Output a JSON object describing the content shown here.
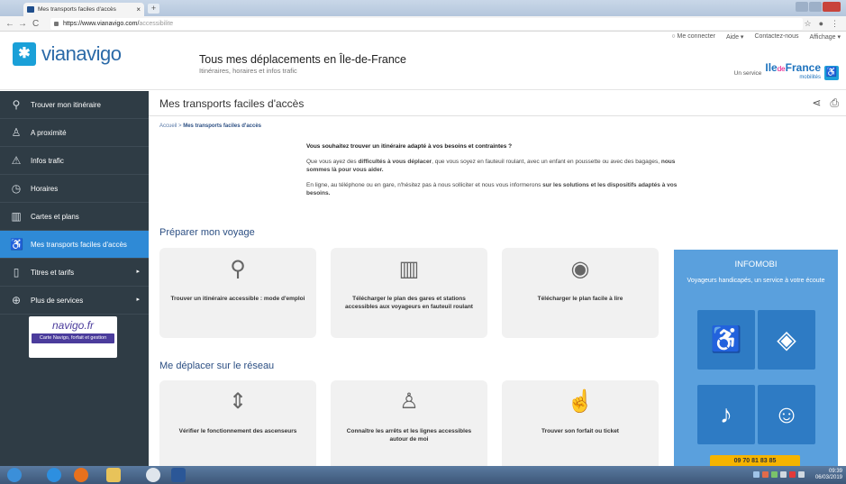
{
  "browser": {
    "tab_title": "Mes transports faciles d'accès",
    "url_host": "https://www.vianavigo.com/",
    "url_path": "accessibilite"
  },
  "header": {
    "logo": "vianavigo",
    "title": "Tous mes déplacements en Île-de-France",
    "subtitle": "Itinéraires, horaires et infos trafic",
    "links": [
      "Me connecter",
      "Aide",
      "Contactez-nous",
      "Affichage"
    ],
    "service_label": "Un service",
    "brand_a": "Ile",
    "brand_b": "de",
    "brand_c": "France",
    "brand_sub": "mobilités"
  },
  "sidebar": {
    "items": [
      {
        "label": "Trouver mon itinéraire",
        "icon": "map-pin-icon"
      },
      {
        "label": "A proximité",
        "icon": "person-location-icon"
      },
      {
        "label": "Infos trafic",
        "icon": "warning-icon"
      },
      {
        "label": "Horaires",
        "icon": "clock-icon"
      },
      {
        "label": "Cartes et plans",
        "icon": "map-icon"
      },
      {
        "label": "Mes transports faciles d'accès",
        "icon": "accessibility-icon"
      },
      {
        "label": "Titres et tarifs",
        "icon": "ticket-icon"
      },
      {
        "label": "Plus de services",
        "icon": "plus-icon"
      }
    ],
    "navigo_logo": "navigo.fr",
    "navigo_bar": "Carte Navigo, forfait et gestion"
  },
  "main": {
    "page_title": "Mes transports faciles d'accès",
    "breadcrumb_home": "Accueil",
    "breadcrumb_sep": ">",
    "breadcrumb_current": "Mes transports faciles d'accès",
    "intro_q": "Vous souhaitez trouver un itinéraire adapté à vos besoins et contraintes ?",
    "intro_p1_a": "Que vous ayez des ",
    "intro_p1_b": "difficultés à vous déplacer",
    "intro_p1_c": ", que vous soyez en fauteuil roulant, avec un enfant en poussette ou avec des bagages, ",
    "intro_p1_d": "nous sommes là pour vous aider.",
    "intro_p2_a": "En ligne, au téléphone ou en gare, n'hésitez pas à nous solliciter et nous vous informerons ",
    "intro_p2_b": "sur les solutions et les dispositifs adaptés à vos besoins.",
    "section1": "Préparer mon voyage",
    "section2": "Me déplacer sur le réseau",
    "cards1": [
      "Trouver un itinéraire accessible : mode d'emploi",
      "Télécharger le plan des gares et stations accessibles aux voyageurs en fauteuil roulant",
      "Télécharger le plan facile à lire"
    ],
    "cards2": [
      "Vérifier le fonctionnement des ascenseurs",
      "Connaître les arrêts et les lignes accessibles autour de moi",
      "Trouver son forfait ou ticket"
    ]
  },
  "infomobi": {
    "title": "INFOMOBI",
    "desc": "Voyageurs handicapés, un service à votre écoute",
    "phone": "09 70 81 83 85"
  },
  "taskbar": {
    "time": "09:39",
    "date": "06/03/2019"
  }
}
